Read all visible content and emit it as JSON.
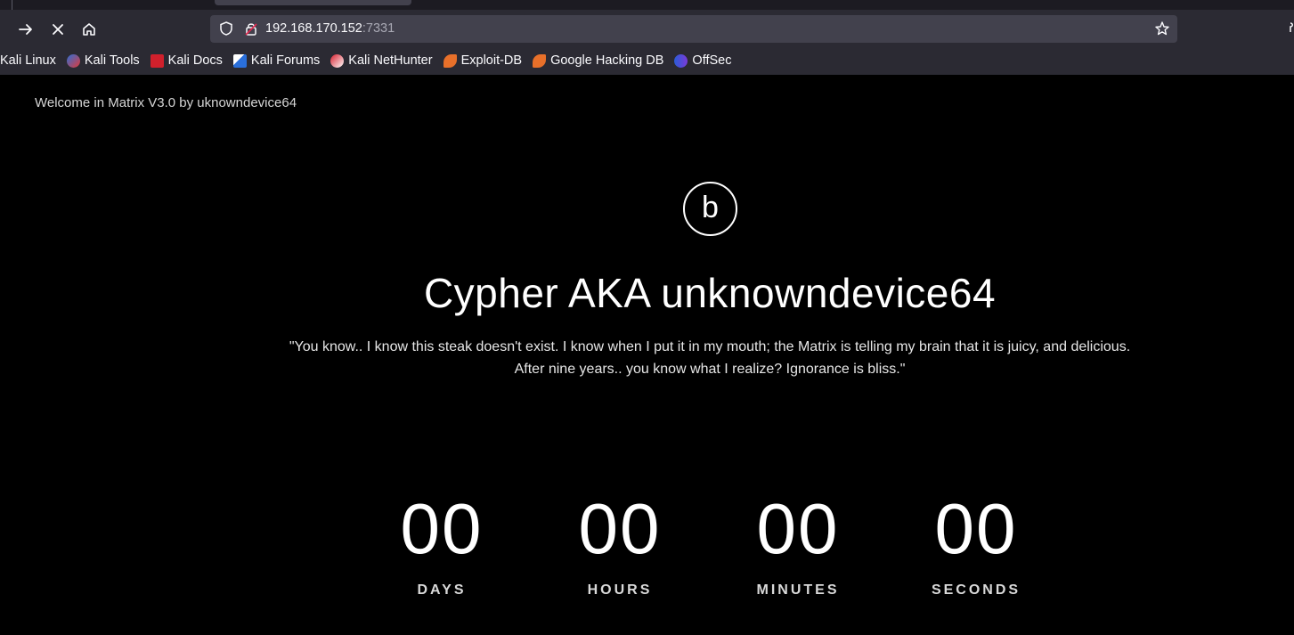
{
  "browser": {
    "url_host": "192.168.170.152",
    "url_port": ":7331",
    "bookmarks": [
      {
        "label": "Kali Linux",
        "icon": "none"
      },
      {
        "label": "Kali Tools",
        "icon": "kali-tools-icon"
      },
      {
        "label": "Kali Docs",
        "icon": "kali-docs-icon"
      },
      {
        "label": "Kali Forums",
        "icon": "kali-forums-icon"
      },
      {
        "label": "Kali NetHunter",
        "icon": "kali-nethunter-icon"
      },
      {
        "label": "Exploit-DB",
        "icon": "exploit-db-icon"
      },
      {
        "label": "Google Hacking DB",
        "icon": "ghdb-icon"
      },
      {
        "label": "OffSec",
        "icon": "offsec-icon"
      }
    ]
  },
  "page": {
    "welcome": "Welcome in Matrix V3.0 by uknowndevice64",
    "logo_letter": "b",
    "title": "Cypher AKA unknowndevice64",
    "quote_line1": "\"You know.. I know this steak doesn't exist. I know when I put it in my mouth; the Matrix is telling my brain that it is juicy, and delicious.",
    "quote_line2": "After nine years.. you know what I realize? Ignorance is bliss.\"",
    "countdown": [
      {
        "value": "00",
        "label": "DAYS"
      },
      {
        "value": "00",
        "label": "HOURS"
      },
      {
        "value": "00",
        "label": "MINUTES"
      },
      {
        "value": "00",
        "label": "SECONDS"
      }
    ]
  }
}
